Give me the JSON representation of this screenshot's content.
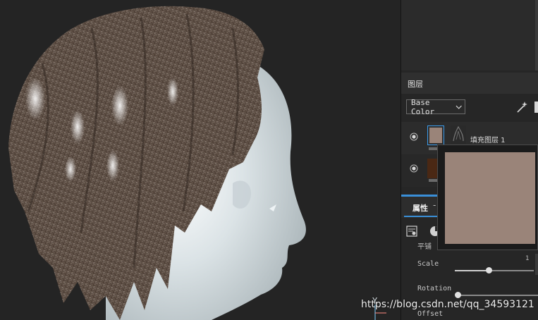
{
  "viewport": {
    "axis_label": "Y",
    "watermark": "https://blog.csdn.net/qq_34593121"
  },
  "layers_panel": {
    "title": "图层",
    "blend_mode": "Base Color",
    "layers": [
      {
        "name": "填充图层 1",
        "thumb_color": "#9a8479",
        "selected": true,
        "visible": true
      },
      {
        "name": "",
        "thumb_color": "#4a2814",
        "selected": false,
        "visible": true
      }
    ]
  },
  "properties_panel": {
    "tab_label": "属性",
    "tab_close": "-",
    "partial_label": "平铺",
    "scale": {
      "label": "Scale",
      "value": "1",
      "fraction": 0.43
    },
    "rotation": {
      "label": "Rotation",
      "fraction": 0.0
    },
    "offset": {
      "label": "Offset"
    }
  },
  "color_popup": {
    "color": "#9a8479"
  },
  "colors": {
    "accent": "#3a8fd8",
    "panel_bg": "#262626",
    "viewport_bg": "#242424"
  },
  "icons": [
    "eye-icon",
    "chevron-down-icon",
    "magic-wand-icon",
    "texture-settings-icon",
    "color-wheel-icon"
  ]
}
